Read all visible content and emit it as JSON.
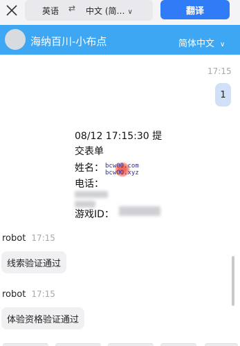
{
  "translate_bar": {
    "source_lang": "英语",
    "swap_symbol": "⇄",
    "target_lang": "中文 (简…",
    "translate_button": "翻译"
  },
  "chat_header": {
    "title": "海纳百川-小布点",
    "language": "简体中文"
  },
  "messages": {
    "user_time": "17:15",
    "user_text": "1",
    "form_lines": [
      "08/12 17:15:30 提",
      "交表单",
      "姓名：",
      "电话：",
      "游戏ID："
    ],
    "watermark": [
      "bcw00.com",
      "bcwOO.xyz"
    ],
    "bot1_sender": "robot",
    "bot1_time": "17:15",
    "bot1_text": "线索验证通过",
    "bot2_sender": "robot",
    "bot2_time": "17:15",
    "bot2_text": "体验资格验证通过"
  },
  "colors": {
    "header": "#3ea7f3",
    "translate_button": "#2f7cf6",
    "user_bubble": "#cfe0f8",
    "bot_bubble": "#f0f0f2"
  },
  "icons": [
    "close-icon",
    "swap-icon",
    "chevron-down-icon"
  ]
}
